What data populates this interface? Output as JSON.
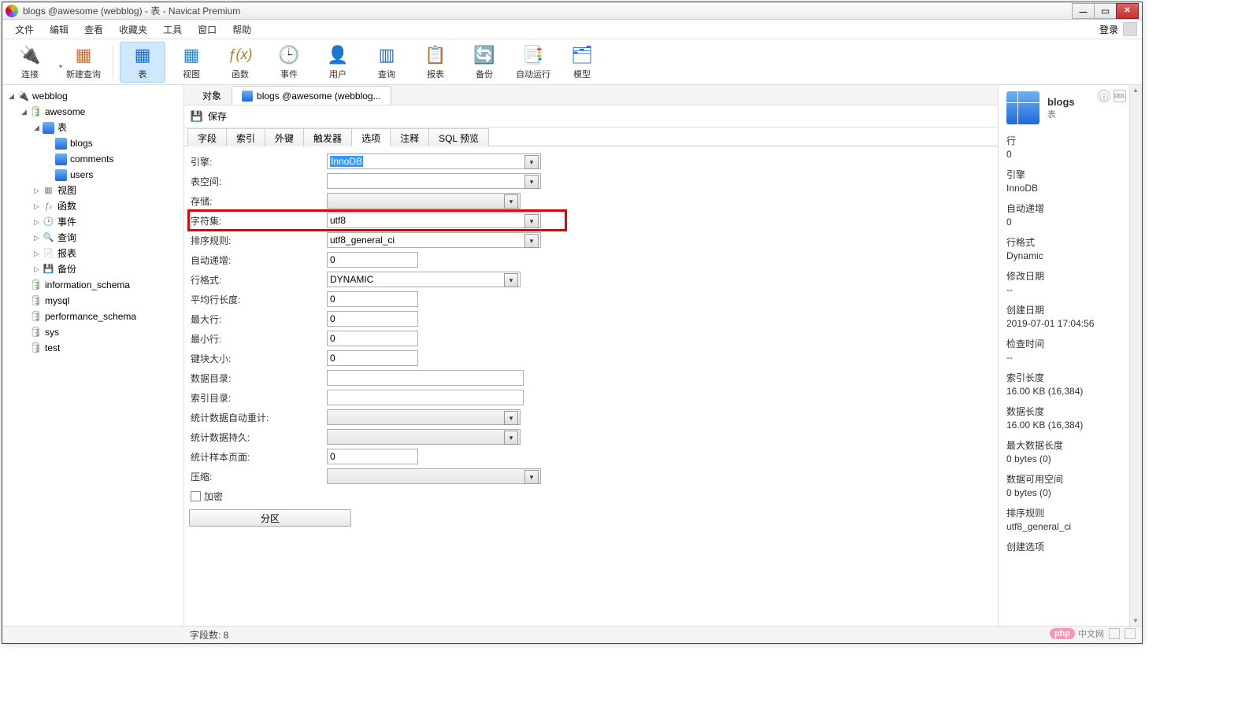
{
  "window": {
    "title": "blogs @awesome (webblog) - 表 - Navicat Premium"
  },
  "menu": {
    "items": [
      "文件",
      "编辑",
      "查看",
      "收藏夹",
      "工具",
      "窗口",
      "帮助"
    ],
    "login": "登录"
  },
  "toolbar": {
    "items": [
      {
        "id": "connect",
        "label": "连接",
        "icon": "🔌",
        "drop": true
      },
      {
        "id": "newquery",
        "label": "新建查询",
        "icon": "📄"
      },
      {
        "id": "sep"
      },
      {
        "id": "table",
        "label": "表",
        "icon": "▦",
        "active": true
      },
      {
        "id": "view",
        "label": "视图",
        "icon": "▦"
      },
      {
        "id": "func",
        "label": "函数",
        "icon": "ƒ(x)"
      },
      {
        "id": "event",
        "label": "事件",
        "icon": "🕒"
      },
      {
        "id": "user",
        "label": "用户",
        "icon": "👤"
      },
      {
        "id": "query",
        "label": "查询",
        "icon": "📊"
      },
      {
        "id": "report",
        "label": "报表",
        "icon": "📋"
      },
      {
        "id": "backup",
        "label": "备份",
        "icon": "🔄"
      },
      {
        "id": "auto",
        "label": "自动运行",
        "icon": "📑"
      },
      {
        "id": "model",
        "label": "模型",
        "icon": "🗂"
      }
    ]
  },
  "tree": {
    "root": "webblog",
    "db": "awesome",
    "tables_group": "表",
    "tables": [
      "blogs",
      "comments",
      "users"
    ],
    "nodes": [
      {
        "label": "视图",
        "ic": "ic-view"
      },
      {
        "label": "函数",
        "ic": "ic-func"
      },
      {
        "label": "事件",
        "ic": "ic-event"
      },
      {
        "label": "查询",
        "ic": "ic-query"
      },
      {
        "label": "报表",
        "ic": "ic-report"
      },
      {
        "label": "备份",
        "ic": "ic-backup"
      }
    ],
    "sys_dbs": [
      "information_schema",
      "mysql",
      "performance_schema",
      "sys",
      "test"
    ]
  },
  "obj_tabs": {
    "obj": "对象",
    "current": "blogs @awesome (webblog..."
  },
  "save_bar": {
    "save": "保存"
  },
  "sub_tabs": [
    "字段",
    "索引",
    "外键",
    "触发器",
    "选项",
    "注释",
    "SQL 预览"
  ],
  "active_sub_tab": 4,
  "form": {
    "engine": {
      "label": "引擎:",
      "value": "InnoDB"
    },
    "tablespace": {
      "label": "表空间:",
      "value": ""
    },
    "storage": {
      "label": "存储:",
      "value": ""
    },
    "charset": {
      "label": "字符集:",
      "value": "utf8"
    },
    "collation": {
      "label": "排序规则:",
      "value": "utf8_general_ci"
    },
    "autoinc": {
      "label": "自动递增:",
      "value": "0"
    },
    "rowfmt": {
      "label": "行格式:",
      "value": "DYNAMIC"
    },
    "avgrow": {
      "label": "平均行长度:",
      "value": "0"
    },
    "maxrow": {
      "label": "最大行:",
      "value": "0"
    },
    "minrow": {
      "label": "最小行:",
      "value": "0"
    },
    "keyblock": {
      "label": "键块大小:",
      "value": "0"
    },
    "datadir": {
      "label": "数据目录:",
      "value": ""
    },
    "indexdir": {
      "label": "索引目录:",
      "value": ""
    },
    "statsauto": {
      "label": "统计数据自动重计:",
      "value": ""
    },
    "statspersist": {
      "label": "统计数据持久:",
      "value": ""
    },
    "statspages": {
      "label": "统计样本页面:",
      "value": "0"
    },
    "compress": {
      "label": "压缩:",
      "value": ""
    },
    "encrypt": {
      "label": "加密"
    },
    "partition": {
      "label": "分区"
    }
  },
  "info": {
    "title": "blogs",
    "subtitle": "表",
    "props": [
      {
        "k": "行",
        "v": "0"
      },
      {
        "k": "引擎",
        "v": "InnoDB"
      },
      {
        "k": "自动递增",
        "v": "0"
      },
      {
        "k": "行格式",
        "v": "Dynamic"
      },
      {
        "k": "修改日期",
        "v": "--"
      },
      {
        "k": "创建日期",
        "v": "2019-07-01 17:04:56"
      },
      {
        "k": "检查时间",
        "v": "--"
      },
      {
        "k": "索引长度",
        "v": "16.00 KB (16,384)"
      },
      {
        "k": "数据长度",
        "v": "16.00 KB (16,384)"
      },
      {
        "k": "最大数据长度",
        "v": "0 bytes (0)"
      },
      {
        "k": "数据可用空间",
        "v": "0 bytes (0)"
      },
      {
        "k": "排序规则",
        "v": "utf8_general_ci"
      },
      {
        "k": "创建选项",
        "v": ""
      }
    ]
  },
  "status": {
    "fields": "字段数: 8"
  },
  "watermark": {
    "badge": "php",
    "text": "中文网"
  }
}
